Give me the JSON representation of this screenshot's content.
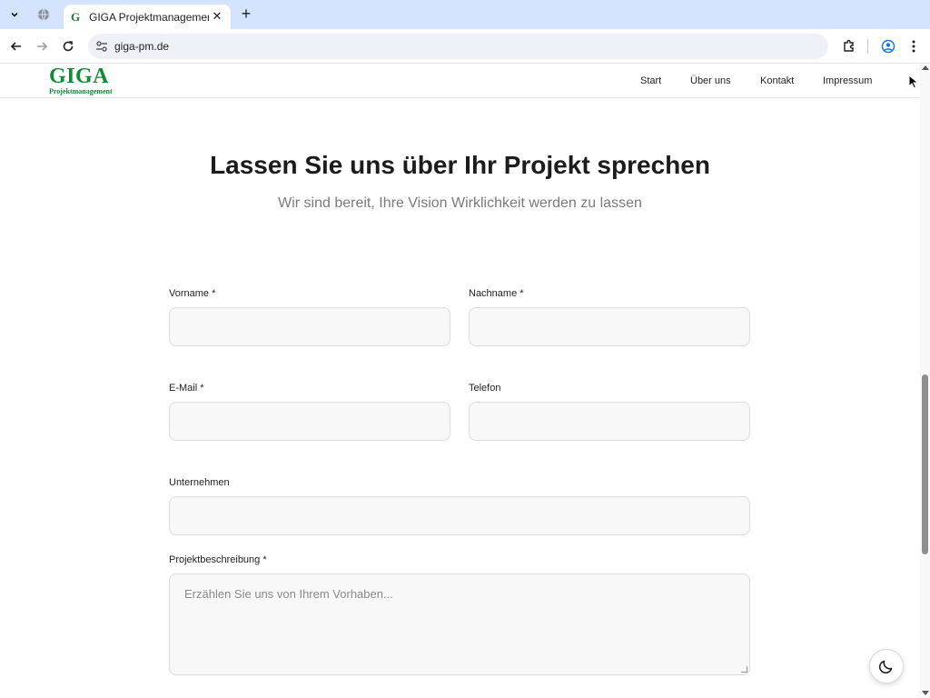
{
  "browser": {
    "active_tab_title": "GIGA Projektmanagement -",
    "url": "giga-pm.de"
  },
  "site": {
    "logo_main": "GIGA",
    "logo_sub": "Projektmanagement",
    "nav": [
      "Start",
      "Über uns",
      "Kontakt",
      "Impressum"
    ]
  },
  "hero": {
    "title": "Lassen Sie uns über Ihr Projekt sprechen",
    "subtitle": "Wir sind bereit, Ihre Vision Wirklichkeit werden zu lassen"
  },
  "form": {
    "firstname_label": "Vorname *",
    "lastname_label": "Nachname *",
    "email_label": "E-Mail *",
    "phone_label": "Telefon",
    "company_label": "Unternehmen",
    "description_label": "Projektbeschreibung *",
    "description_placeholder": "Erzählen Sie uns von Ihrem Vorhaben...",
    "firstname_value": "",
    "lastname_value": "",
    "email_value": "",
    "phone_value": "",
    "company_value": ""
  },
  "colors": {
    "brand_green": "#138a36",
    "tabstrip": "#d3e3fd"
  }
}
